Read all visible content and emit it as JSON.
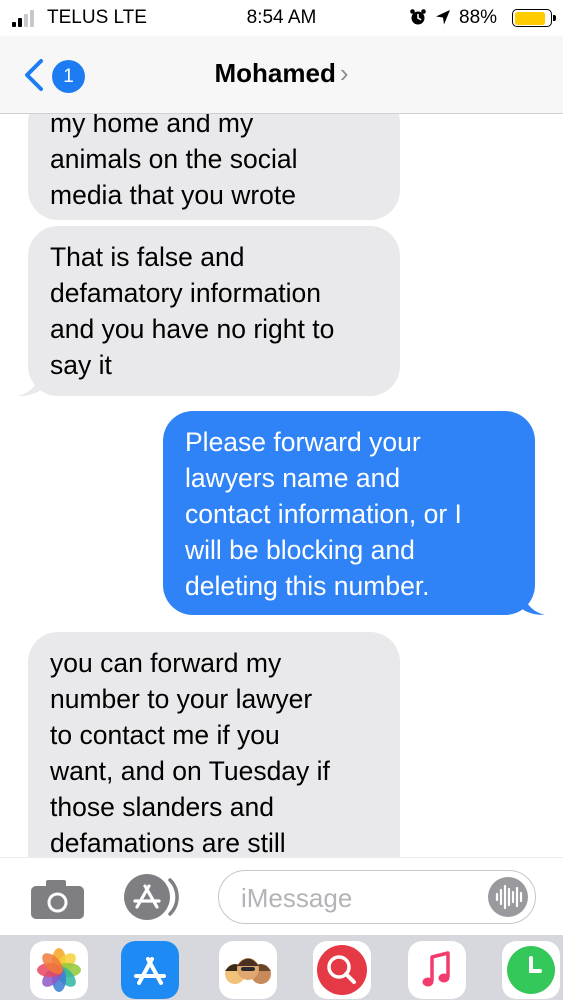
{
  "status_bar": {
    "carrier": "TELUS LTE",
    "time": "8:54 AM",
    "battery_percent": "88%",
    "battery_level": 0.88,
    "battery_color": "#ffcc00"
  },
  "header": {
    "back_badge_count": "1",
    "contact_name": "Mohamed",
    "accent_color": "#1e7cf2"
  },
  "messages": [
    {
      "direction": "received",
      "lines": [
        "my home and my",
        "animals on the social",
        "media that you wrote"
      ]
    },
    {
      "direction": "received",
      "lines": [
        "That is false and",
        "defamatory information",
        "and you have no right to",
        "say it"
      ]
    },
    {
      "direction": "sent",
      "lines": [
        "Please forward your",
        "lawyers name and",
        "contact information, or I",
        "will be blocking and",
        "deleting this number."
      ]
    },
    {
      "direction": "received",
      "lines": [
        "you can forward my",
        "number to your lawyer",
        "to contact me if you",
        "want, and on Tuesday if",
        "those slanders and",
        "defamations are still"
      ]
    }
  ],
  "compose": {
    "placeholder": "iMessage",
    "icons": [
      "camera-icon",
      "app-store-icon",
      "audio-message-icon"
    ]
  },
  "app_drawer": {
    "apps": [
      "photos-app-icon",
      "app-store-app-icon",
      "memoji-app-icon",
      "image-search-app-icon",
      "music-app-icon",
      "screen-time-app-icon"
    ]
  },
  "colors": {
    "sent_bubble": "#2f83f6",
    "received_bubble": "#e9e9eb"
  }
}
